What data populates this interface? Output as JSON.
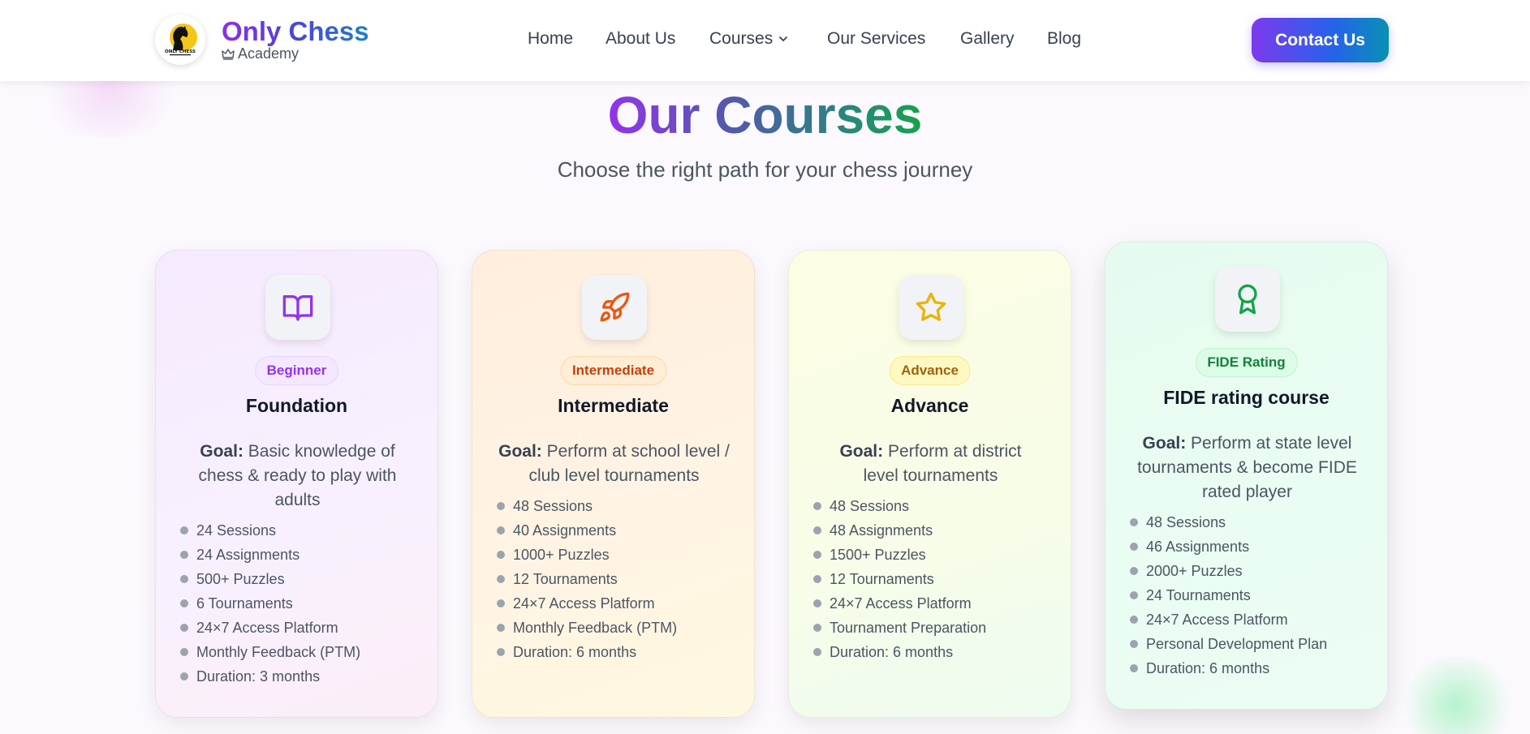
{
  "header": {
    "brand_name": "Only Chess",
    "brand_sub": "Academy",
    "logo_text": "ONLY CHESS",
    "nav": [
      "Home",
      "About Us",
      "Courses",
      "Our Services",
      "Gallery",
      "Blog"
    ],
    "contact_label": "Contact Us"
  },
  "section": {
    "title": "Our Courses",
    "subtitle": "Choose the right path for your chess journey"
  },
  "goal_label": "Goal:",
  "courses": [
    {
      "badge": "Beginner",
      "title": "Foundation",
      "goal": "Basic knowledge of chess & ready to play with adults",
      "features": [
        "24 Sessions",
        "24 Assignments",
        "500+ Puzzles",
        "6 Tournaments",
        "24×7 Access Platform",
        "Monthly Feedback (PTM)",
        "Duration: 3 months"
      ],
      "icon": "book-open-icon",
      "accent": "#9333ea"
    },
    {
      "badge": "Intermediate",
      "title": "Intermediate",
      "goal": "Perform at school level / club level tournaments",
      "features": [
        "48 Sessions",
        "40 Assignments",
        "1000+ Puzzles",
        "12 Tournaments",
        "24×7 Access Platform",
        "Monthly Feedback (PTM)",
        "Duration: 6 months"
      ],
      "icon": "rocket-icon",
      "accent": "#ea580c"
    },
    {
      "badge": "Advance",
      "title": "Advance",
      "goal": "Perform at district level tournaments",
      "features": [
        "48 Sessions",
        "48 Assignments",
        "1500+ Puzzles",
        "12 Tournaments",
        "24×7 Access Platform",
        "Tournament Preparation",
        "Duration: 6 months"
      ],
      "icon": "star-icon",
      "accent": "#eab308"
    },
    {
      "badge": "FIDE Rating",
      "title": "FIDE rating course",
      "goal": "Perform at state level tournaments & become FIDE rated player",
      "features": [
        "48 Sessions",
        "46 Assignments",
        "2000+ Puzzles",
        "24 Tournaments",
        "24×7 Access Platform",
        "Personal Development Plan",
        "Duration: 6 months"
      ],
      "icon": "award-icon",
      "accent": "#16a34a"
    }
  ]
}
